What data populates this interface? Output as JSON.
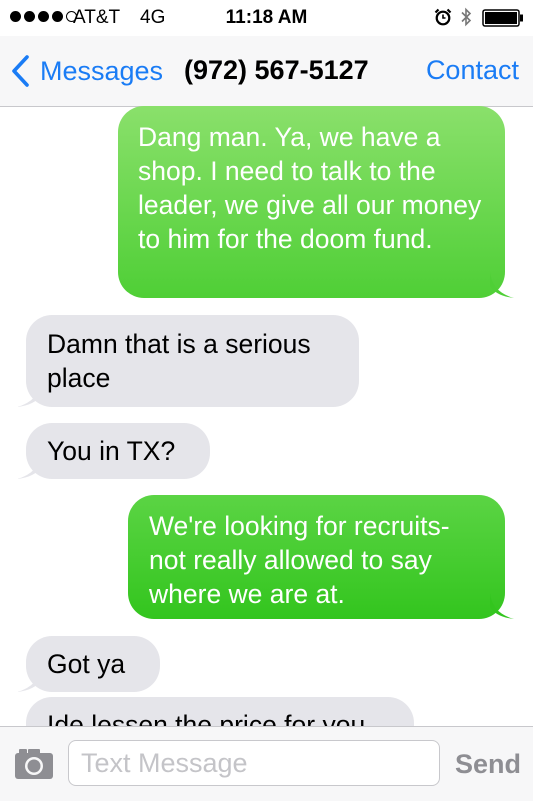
{
  "status_bar": {
    "signal_bars": 5,
    "signal_filled": 4,
    "carrier": "AT&T",
    "network": "4G",
    "time": "11:18 AM",
    "icons": [
      "alarm-icon",
      "bluetooth-icon",
      "battery-icon"
    ],
    "battery_level": 1.0
  },
  "nav": {
    "back_label": "Messages",
    "title": "(972) 567-5127",
    "contact_label": "Contact"
  },
  "messages": [
    {
      "direction": "sent",
      "text": "Dang man.  Ya, we have a shop.  I need to talk to the leader, we give all our money to him for the doom fund."
    },
    {
      "direction": "received",
      "text": "Damn that is a serious place"
    },
    {
      "direction": "received",
      "text": "You in TX?"
    },
    {
      "direction": "sent",
      "text": "We're looking for recruits- not really allowed to say where we are at."
    },
    {
      "direction": "received",
      "text": "Got ya"
    },
    {
      "direction": "received",
      "text": "Ide lessen the price for you"
    }
  ],
  "composer": {
    "placeholder": "Text Message",
    "value": "",
    "send_label": "Send",
    "camera_icon": "camera-icon"
  },
  "colors": {
    "ios_blue": "#1a7cf5",
    "sent_bubble": "#4fcf36",
    "received_bubble": "#e5e5ea"
  }
}
